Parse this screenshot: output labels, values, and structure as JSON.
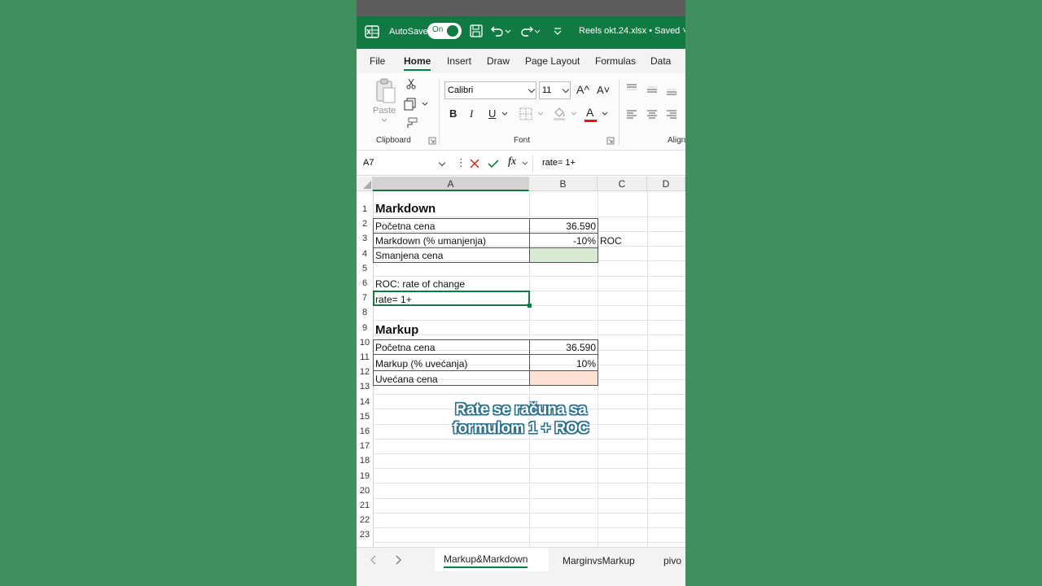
{
  "titlebar": {
    "autosave_label": "AutoSave",
    "toggle_state": "On",
    "filename": "Reels okt.24.xlsx • Saved ˅"
  },
  "tabs": [
    "File",
    "Home",
    "Insert",
    "Draw",
    "Page Layout",
    "Formulas",
    "Data"
  ],
  "ribbon": {
    "paste_label": "Paste",
    "clipboard_label": "Clipboard",
    "font_name": "Calibri",
    "font_size": "11",
    "grow_font": "A^",
    "shrink_font": "A˅",
    "bold": "B",
    "italic": "I",
    "underline": "U",
    "font_color_letter": "A",
    "font_label": "Font",
    "align_label": "Align"
  },
  "formula_bar": {
    "name_box": "A7",
    "fx": "fx",
    "content": "rate= 1+"
  },
  "columns": [
    "A",
    "B",
    "C",
    "D"
  ],
  "rows": [
    "1",
    "2",
    "3",
    "4",
    "5",
    "6",
    "7",
    "8",
    "9",
    "10",
    "11",
    "12",
    "13",
    "14",
    "15",
    "16",
    "17",
    "18",
    "19",
    "20",
    "21",
    "22",
    "23"
  ],
  "cells": {
    "a1": "Markdown",
    "a2": "Početna cena",
    "b2": "36.590",
    "a3": "Markdown (% umanjenja)",
    "b3": "-10%",
    "c3": "ROC",
    "a4": "Smanjena cena",
    "a6": "ROC: rate of change",
    "a7": "rate= 1+",
    "a9": "Markup",
    "a10": "Početna cena",
    "b10": "36.590",
    "a11": "Markup (% uvećanja)",
    "b11": "10%",
    "a12": "Uvećana cena"
  },
  "caption": {
    "line1": "Rate se računa sa",
    "line2": "formulom  1 + ROC"
  },
  "sheet_tabs": [
    "Markup&Markdown",
    "MarginvsMarkup",
    "pivo"
  ],
  "colors": {
    "excel_green": "#117a43",
    "cell_green": "#d9ead3",
    "cell_peach": "#fbe2d5",
    "background": "#3f8f5f"
  }
}
